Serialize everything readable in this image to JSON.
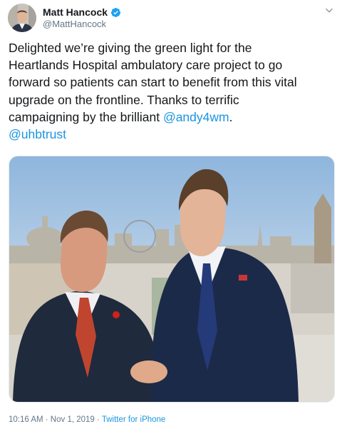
{
  "user": {
    "name": "Matt Hancock",
    "handle": "@MattHancock",
    "verified": true,
    "verified_icon": "verified-badge-icon"
  },
  "menu_icon": "chevron-down-icon",
  "tweet": {
    "line1": "Delighted we’re giving the green light for the",
    "line2": "Heartlands Hospital ambulatory care project to go",
    "line3": "forward so patients can start to benefit from this vital",
    "line4": "upgrade on the frontline. Thanks to terrific",
    "line5_prefix": "campaigning by the brilliant ",
    "mention1": "@andy4wm",
    "line5_suffix": ".",
    "mention2": "@uhbtrust"
  },
  "meta": {
    "timestamp": "10:16 AM · Nov 1, 2019 · ",
    "source": "Twitter for iPhone"
  },
  "colors": {
    "link": "#1b95e0",
    "verified": "#1da1f2",
    "secondary_text": "#657786"
  }
}
